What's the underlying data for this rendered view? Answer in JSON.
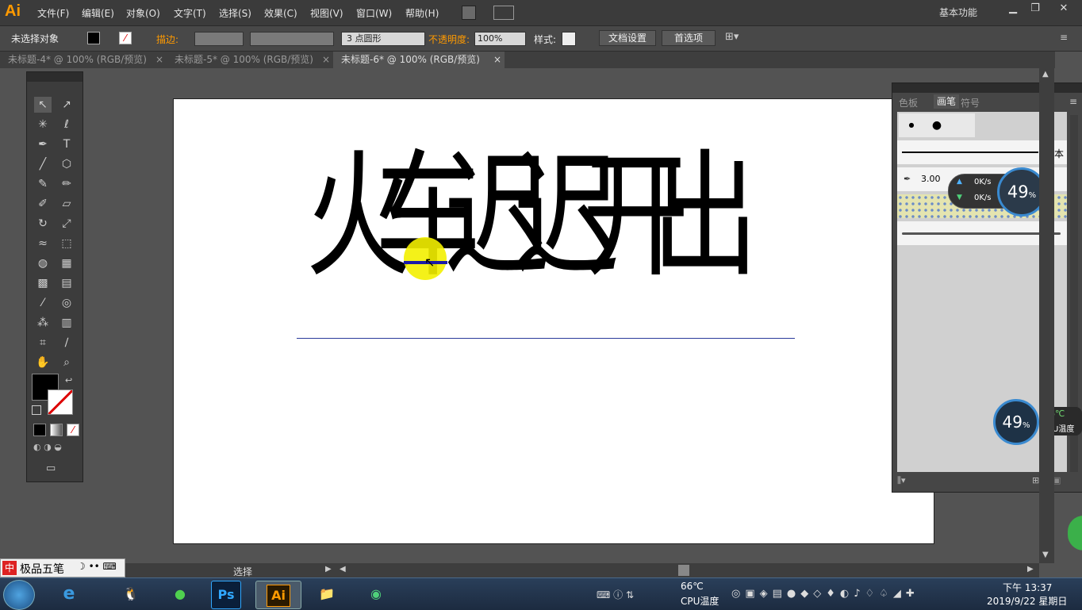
{
  "app": {
    "logo": "Ai"
  },
  "menu": [
    "文件(F)",
    "编辑(E)",
    "对象(O)",
    "文字(T)",
    "选择(S)",
    "效果(C)",
    "视图(V)",
    "窗口(W)",
    "帮助(H)"
  ],
  "workspace": "基本功能",
  "control_bar": {
    "selection": "未选择对象",
    "stroke_label": "描边:",
    "brush": "3 点圆形",
    "opacity_label": "不透明度:",
    "opacity_value": "100%",
    "style_label": "样式:",
    "doc_setup": "文档设置",
    "preferences": "首选项"
  },
  "tabs": [
    {
      "label": "未标题-4* @ 100% (RGB/预览)",
      "active": false
    },
    {
      "label": "未标题-5* @ 100% (RGB/预览)",
      "active": false
    },
    {
      "label": "未标题-6* @ 100% (RGB/预览)",
      "active": true
    }
  ],
  "artboard_text": "火车迟迟开出",
  "right_panel": {
    "tabs": [
      "色板",
      "画笔",
      "符号"
    ],
    "active_tab": "画笔",
    "basic_label": "基本",
    "brush_size": "3.00",
    "net_up": "0K/s",
    "net_down": "0K/s",
    "meter_pct": "49",
    "pct_sign": "%"
  },
  "cpu_widget": {
    "pct": "49",
    "pct_sign": "%",
    "temp": "66℃",
    "label": "CPU温度"
  },
  "ime": {
    "label": "极品五笔"
  },
  "status": {
    "tool": "选择"
  },
  "taskbar": {
    "temp": "66℃",
    "temp_label": "CPU温度",
    "time": "下午 13:37",
    "date": "2019/9/22 星期日"
  },
  "colors": {
    "accent_orange": "#ff9a00",
    "guide_blue": "#2a3a9a",
    "cursor_yellow": "#f3f000"
  }
}
